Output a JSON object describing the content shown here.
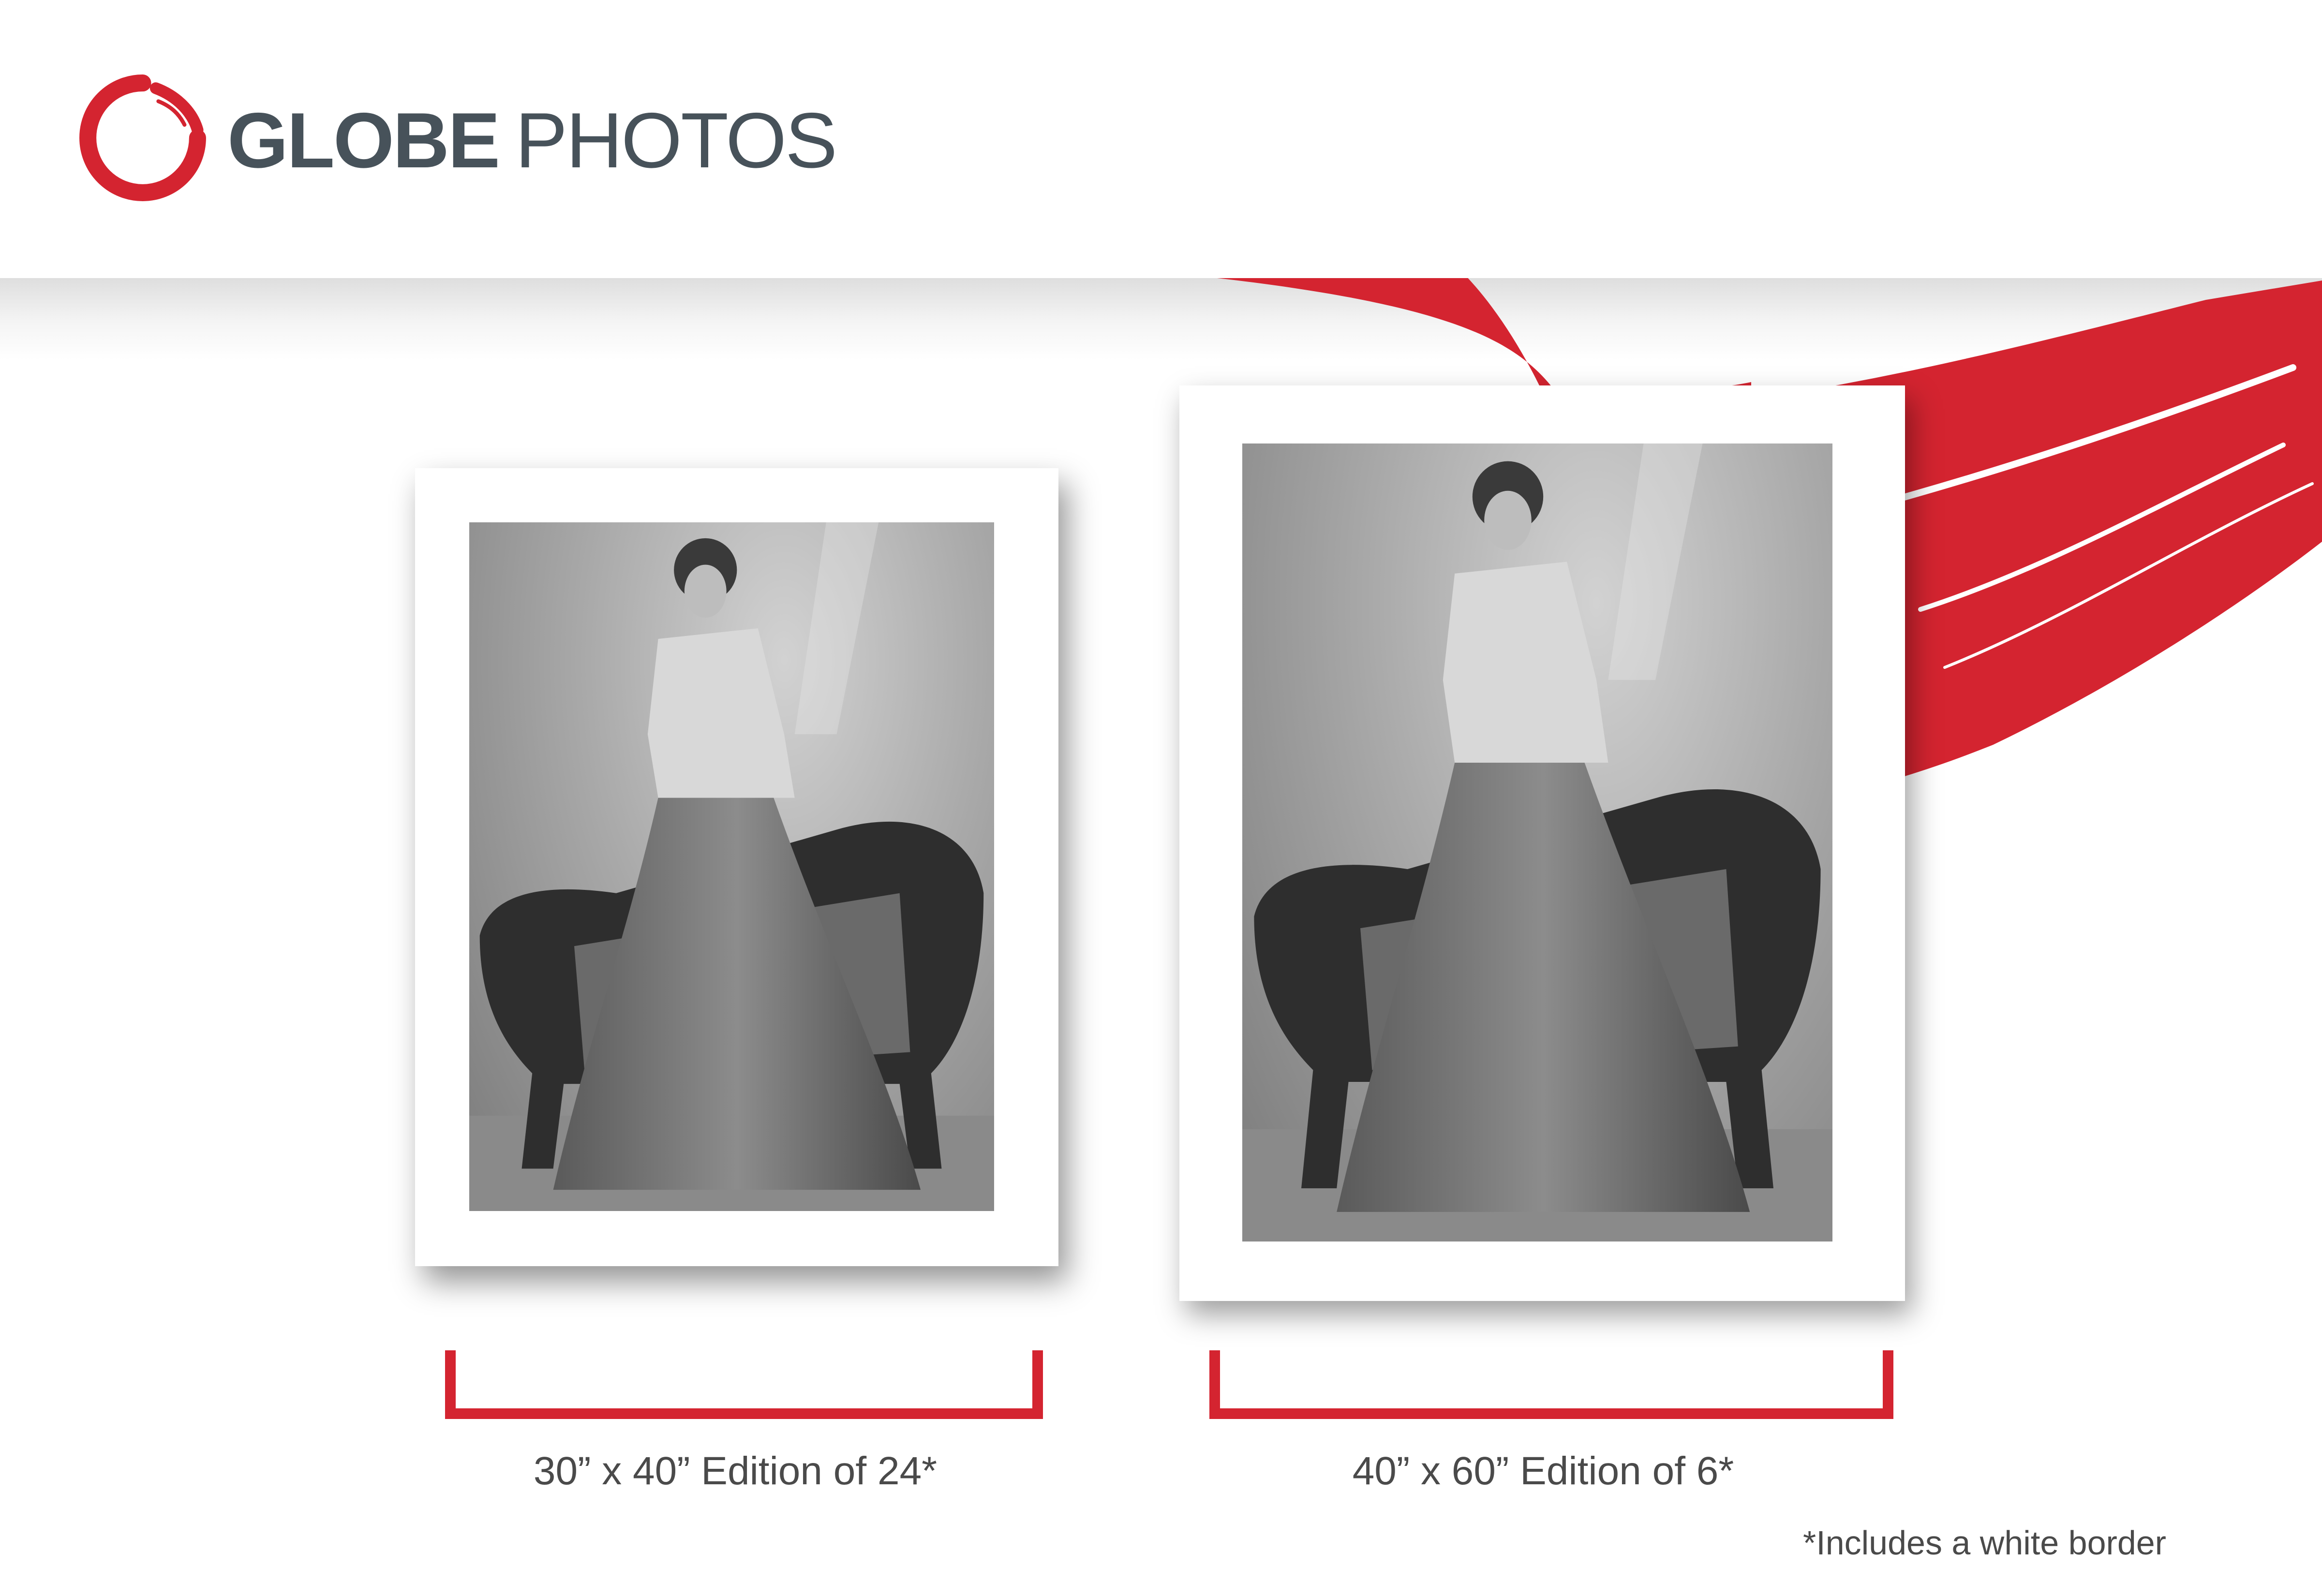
{
  "brand": {
    "name_bold": "GLOBE",
    "name_light": "PHOTOS",
    "logo_icon": "red-brush-circle-icon",
    "accent_color": "#d42430",
    "text_color": "#47525a"
  },
  "prints": [
    {
      "caption": "30” x 40” Edition of 24*",
      "image": "black-and-white-portrait-woman-with-settee"
    },
    {
      "caption": "40” x 60” Edition of 6*",
      "image": "black-and-white-portrait-woman-with-settee"
    }
  ],
  "footnote": "*Includes a white border"
}
